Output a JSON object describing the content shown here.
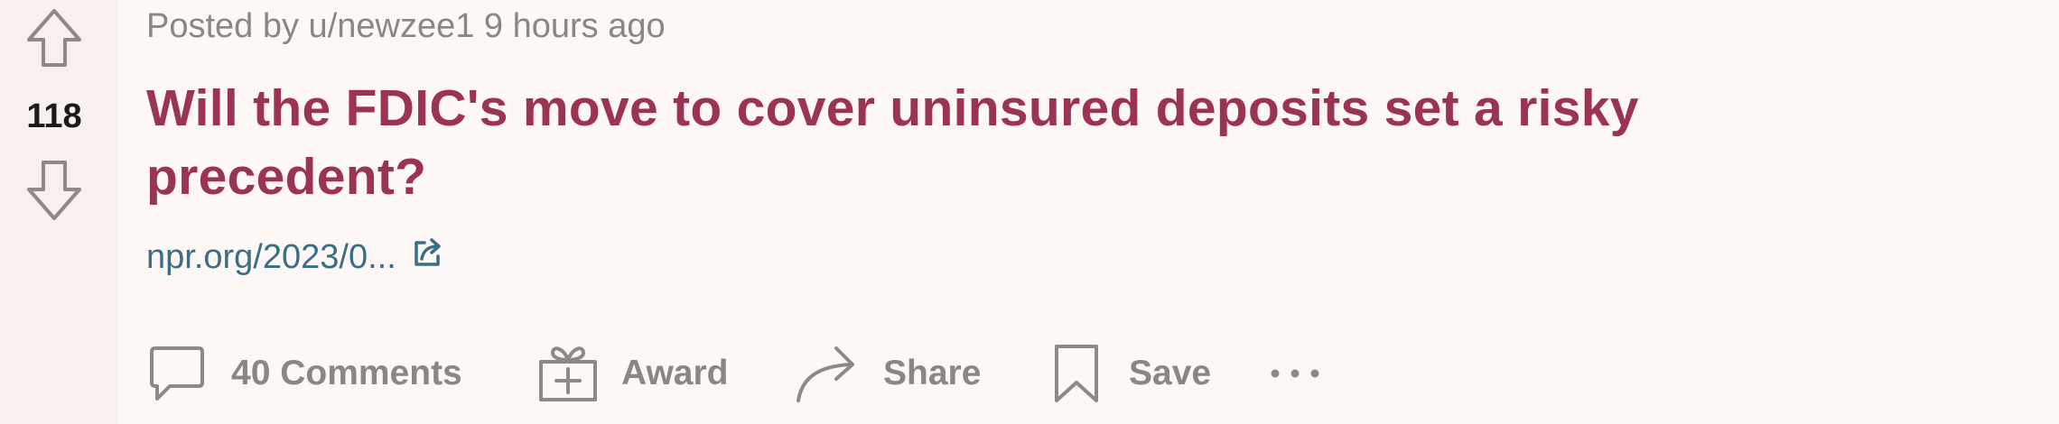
{
  "post": {
    "score": "118",
    "meta": "Posted by u/newzee1 9 hours ago",
    "title": "Will the FDIC's move to cover uninsured deposits set a risky precedent?",
    "link_text": "npr.org/2023/0..."
  },
  "actions": {
    "comments": "40 Comments",
    "award": "Award",
    "share": "Share",
    "save": "Save"
  },
  "icons": {
    "upvote": "arrow-up-outline-icon",
    "downvote": "arrow-down-outline-icon",
    "external_link": "external-link-icon",
    "comments": "speech-bubble-icon",
    "award": "gift-icon",
    "share": "curved-arrow-icon",
    "save": "bookmark-icon",
    "more": "horizontal-ellipsis-icon"
  },
  "colors": {
    "page_background": "#fdf7f5",
    "vote_column_background": "#f7f0ec",
    "title": "#9b3454",
    "link": "#3a6e84",
    "muted_text": "#8a8684",
    "icon_stroke": "#8e8986"
  }
}
